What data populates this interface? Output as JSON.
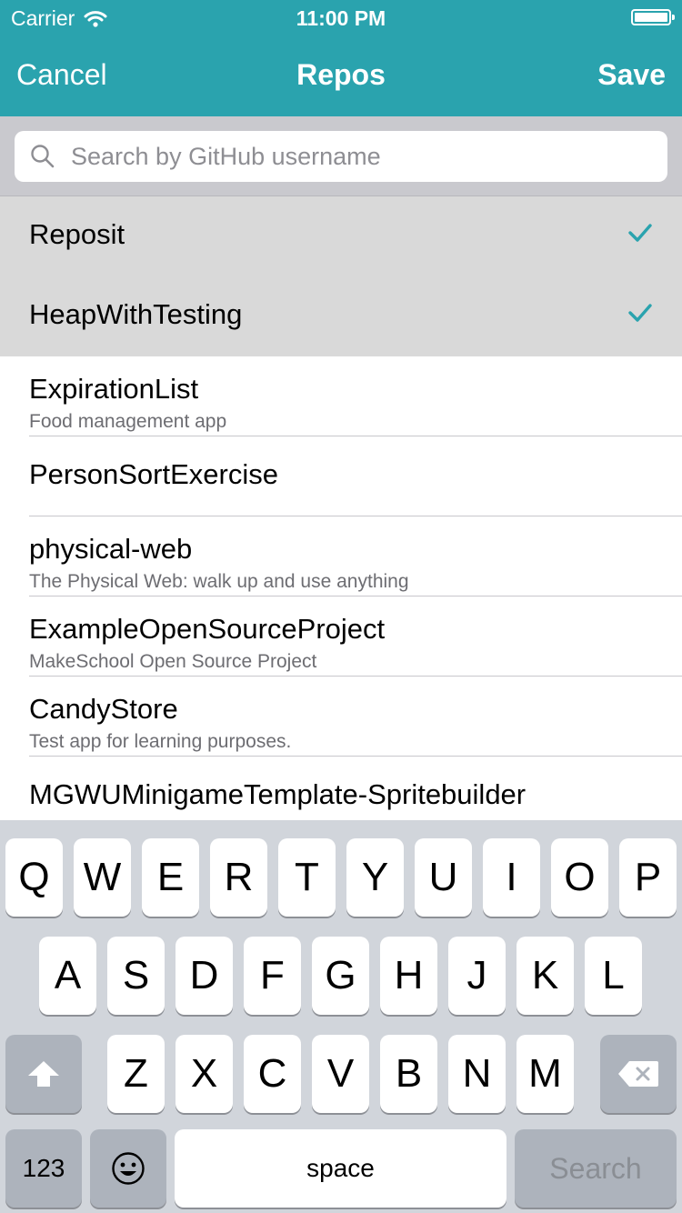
{
  "status_bar": {
    "carrier": "Carrier",
    "time": "11:00 PM"
  },
  "nav": {
    "left_label": "Cancel",
    "title": "Repos",
    "right_label": "Save",
    "color": "#2aa3ae"
  },
  "search": {
    "placeholder": "Search by GitHub username",
    "value": ""
  },
  "repos": [
    {
      "name": "Reposit",
      "description": "",
      "selected": true
    },
    {
      "name": "HeapWithTesting",
      "description": "",
      "selected": true
    },
    {
      "name": "ExpirationList",
      "description": "Food management app",
      "selected": false
    },
    {
      "name": "PersonSortExercise",
      "description": "",
      "selected": false
    },
    {
      "name": "physical-web",
      "description": "The Physical Web: walk up and use anything",
      "selected": false
    },
    {
      "name": "ExampleOpenSourceProject",
      "description": "MakeSchool Open Source Project",
      "selected": false
    },
    {
      "name": "CandyStore",
      "description": "Test app for learning purposes.",
      "selected": false
    },
    {
      "name": "MGWUMinigameTemplate-Spritebuilder",
      "description": "",
      "selected": false
    }
  ],
  "keyboard": {
    "row1": [
      "Q",
      "W",
      "E",
      "R",
      "T",
      "Y",
      "U",
      "I",
      "O",
      "P"
    ],
    "row2": [
      "A",
      "S",
      "D",
      "F",
      "G",
      "H",
      "J",
      "K",
      "L"
    ],
    "row3": [
      "Z",
      "X",
      "C",
      "V",
      "B",
      "N",
      "M"
    ],
    "numbers_label": "123",
    "space_label": "space",
    "search_label": "Search"
  }
}
